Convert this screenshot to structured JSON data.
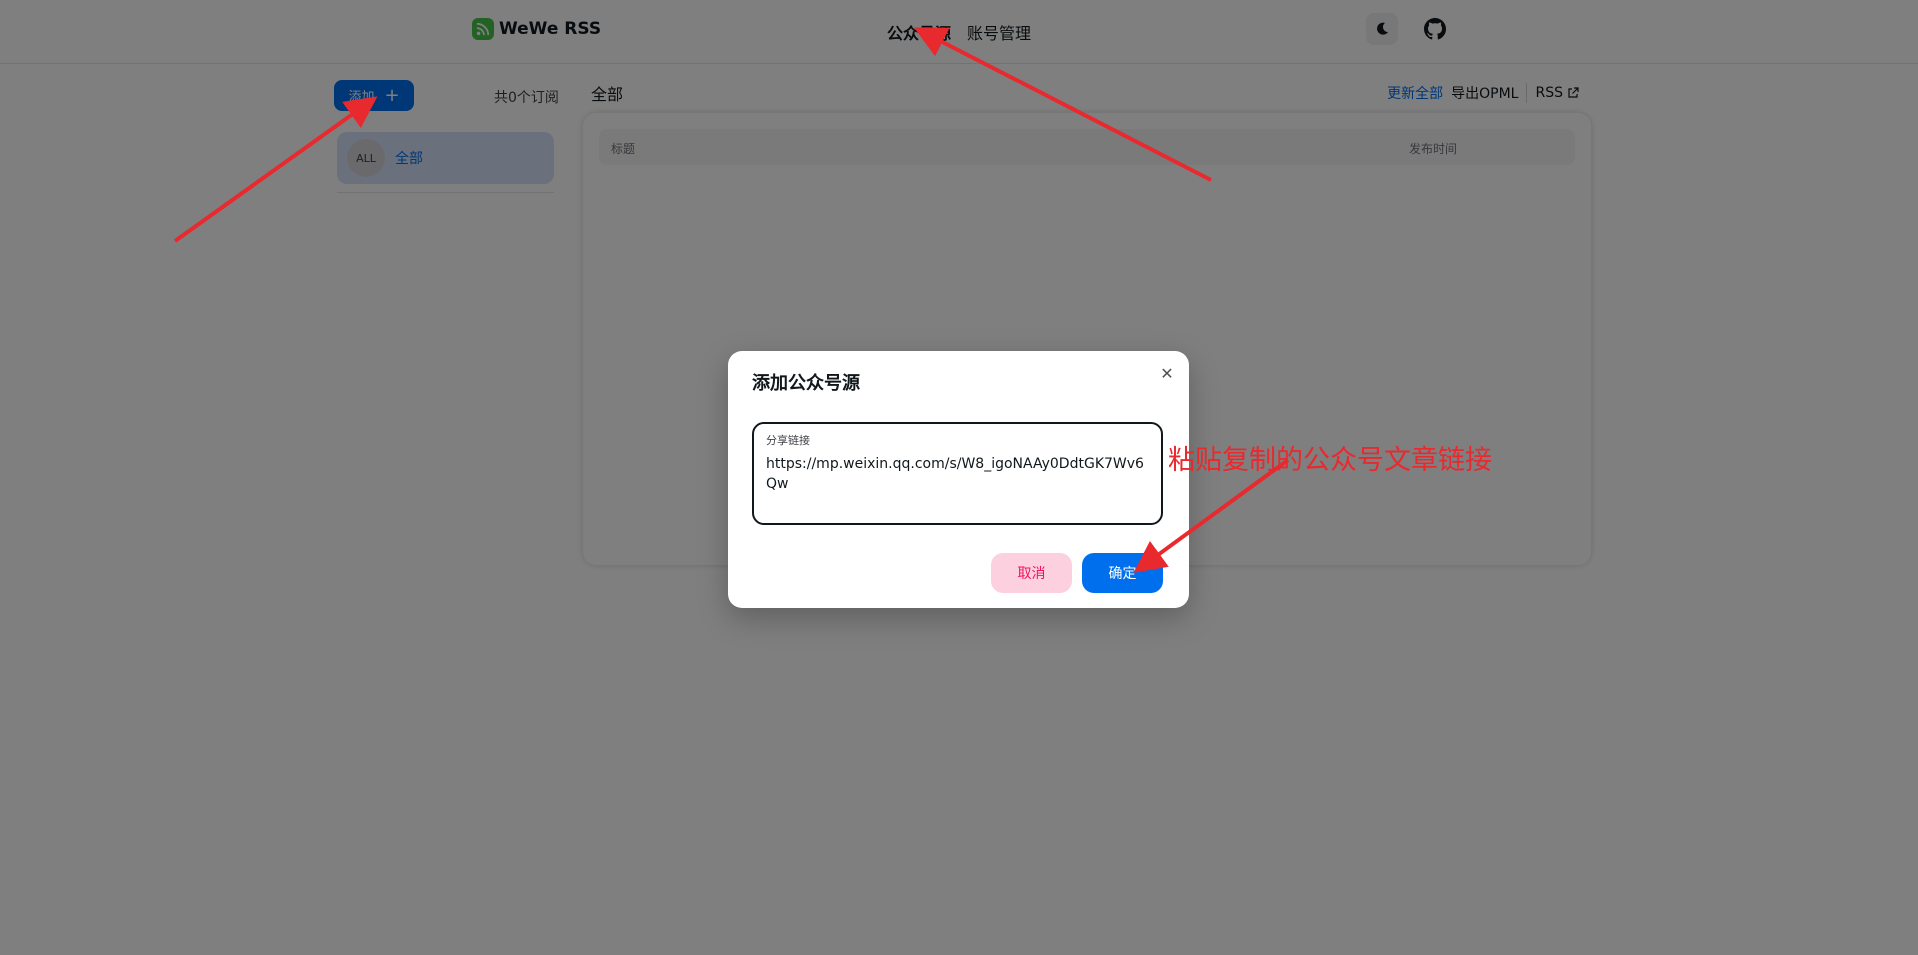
{
  "brand": {
    "name": "WeWe RSS"
  },
  "nav": {
    "sources": "公众号源",
    "accounts": "账号管理"
  },
  "sidebar": {
    "add_label": "添加",
    "count_text": "共0个订阅",
    "items": [
      {
        "avatar": "ALL",
        "label": "全部"
      }
    ]
  },
  "main": {
    "title": "全部",
    "actions": {
      "refresh": "更新全部",
      "export": "导出OPML",
      "rss": "RSS"
    },
    "table": {
      "col_title": "标题",
      "col_time": "发布时间"
    }
  },
  "modal": {
    "title": "添加公众号源",
    "field_label": "分享链接",
    "field_value": "https://mp.weixin.qq.com/s/W8_igoNAAy0DdtGK7Wv6Qw",
    "cancel": "取消",
    "confirm": "确定"
  },
  "annotation": {
    "text": "粘贴复制的公众号文章链接",
    "color": "#e8292e"
  },
  "colors": {
    "primary": "#006fee",
    "danger": "#f31260",
    "logo": "#46c34a"
  },
  "icons": {
    "theme": "moon-icon",
    "github": "github-icon",
    "external": "external-link-icon",
    "close": "close-icon",
    "plus": "plus-icon"
  }
}
